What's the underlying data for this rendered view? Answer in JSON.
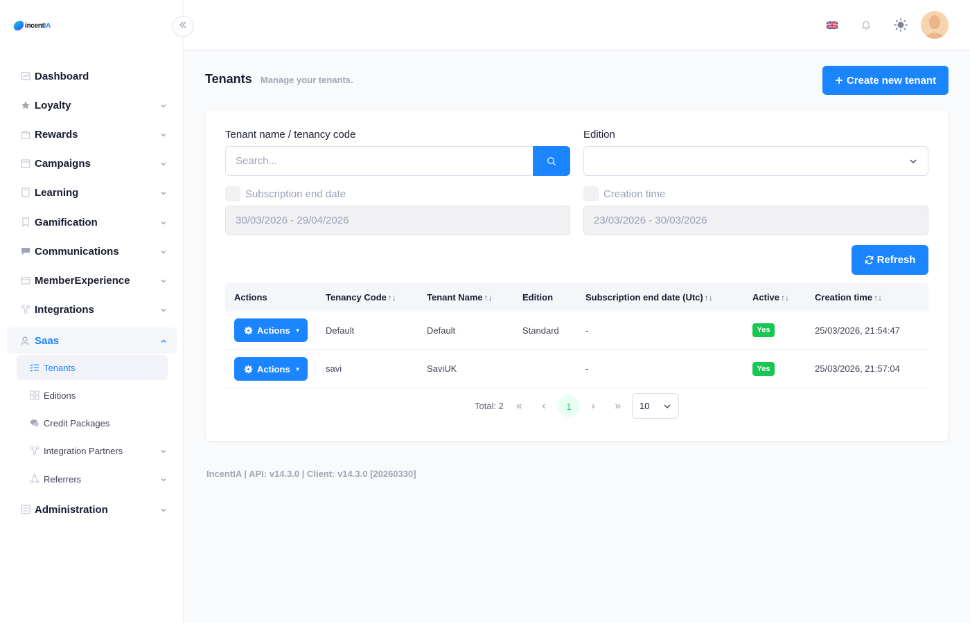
{
  "app": {
    "logo_text_a": "incent",
    "logo_text_b": "IA"
  },
  "sidebar": {
    "items": [
      {
        "label": "Dashboard",
        "icon": "chart-icon"
      },
      {
        "label": "Loyalty",
        "icon": "star-icon"
      },
      {
        "label": "Rewards",
        "icon": "gift-icon"
      },
      {
        "label": "Campaigns",
        "icon": "calendar-icon"
      },
      {
        "label": "Learning",
        "icon": "book-icon"
      },
      {
        "label": "Gamification",
        "icon": "badge-icon"
      },
      {
        "label": "Communications",
        "icon": "chat-icon"
      },
      {
        "label": "MemberExperience",
        "icon": "card-icon"
      },
      {
        "label": "Integrations",
        "icon": "network-icon"
      },
      {
        "label": "Saas",
        "icon": "users-icon"
      },
      {
        "label": "Administration",
        "icon": "admin-icon"
      }
    ],
    "saas_children": [
      {
        "label": "Tenants",
        "icon": "list-icon"
      },
      {
        "label": "Editions",
        "icon": "grid-icon"
      },
      {
        "label": "Credit Packages",
        "icon": "coins-icon"
      },
      {
        "label": "Integration Partners",
        "icon": "network-icon"
      },
      {
        "label": "Referrers",
        "icon": "share-icon"
      }
    ]
  },
  "page": {
    "title": "Tenants",
    "subtitle": "Manage your tenants.",
    "create_button": "Create new tenant"
  },
  "filters": {
    "tenant_label": "Tenant name / tenancy code",
    "search_placeholder": "Search...",
    "edition_label": "Edition",
    "edition_value": "",
    "subscription_label": "Subscription end date",
    "subscription_range": "30/03/2026 - 29/04/2026",
    "creation_label": "Creation time",
    "creation_range": "23/03/2026 - 30/03/2026",
    "refresh_button": "Refresh"
  },
  "table": {
    "columns": [
      "Actions",
      "Tenancy Code",
      "Tenant Name",
      "Edition",
      "Subscription end date (Utc)",
      "Active",
      "Creation time"
    ],
    "rows": [
      {
        "action": "Actions",
        "code": "Default",
        "name": "Default",
        "edition": "Standard",
        "sub_end": "-",
        "active": "Yes",
        "created": "25/03/2026, 21:54:47"
      },
      {
        "action": "Actions",
        "code": "savi",
        "name": "SaviUK",
        "edition": "",
        "sub_end": "-",
        "active": "Yes",
        "created": "25/03/2026, 21:57:04"
      }
    ]
  },
  "pager": {
    "total": "Total: 2",
    "current_page": "1",
    "page_size": "10"
  },
  "footer": {
    "text": "IncentIA | API: v14.3.0 | Client: v14.3.0 [20260330]"
  },
  "colors": {
    "primary": "#1b84ff",
    "success": "#17c653"
  }
}
